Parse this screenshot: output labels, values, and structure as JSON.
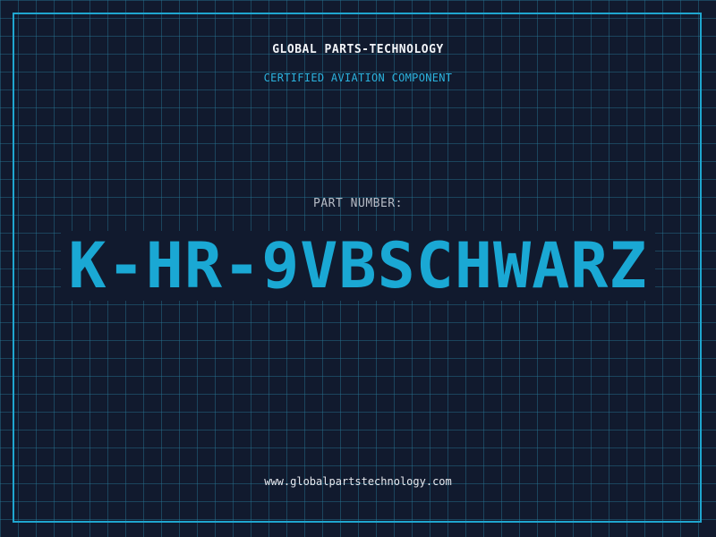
{
  "header": {
    "company": "GLOBAL PARTS-TECHNOLOGY",
    "subtitle": "CERTIFIED AVIATION COMPONENT"
  },
  "part": {
    "label": "PART NUMBER:",
    "number": "K-HR-9VBSCHWARZ"
  },
  "footer": {
    "url": "www.globalpartstechnology.com"
  },
  "colors": {
    "background": "#111a2e",
    "grid": "#287896",
    "accent": "#1aa8d4",
    "frame": "#1fa6cf",
    "text_primary": "#f2f4f8",
    "text_muted": "#b7bcc6"
  }
}
